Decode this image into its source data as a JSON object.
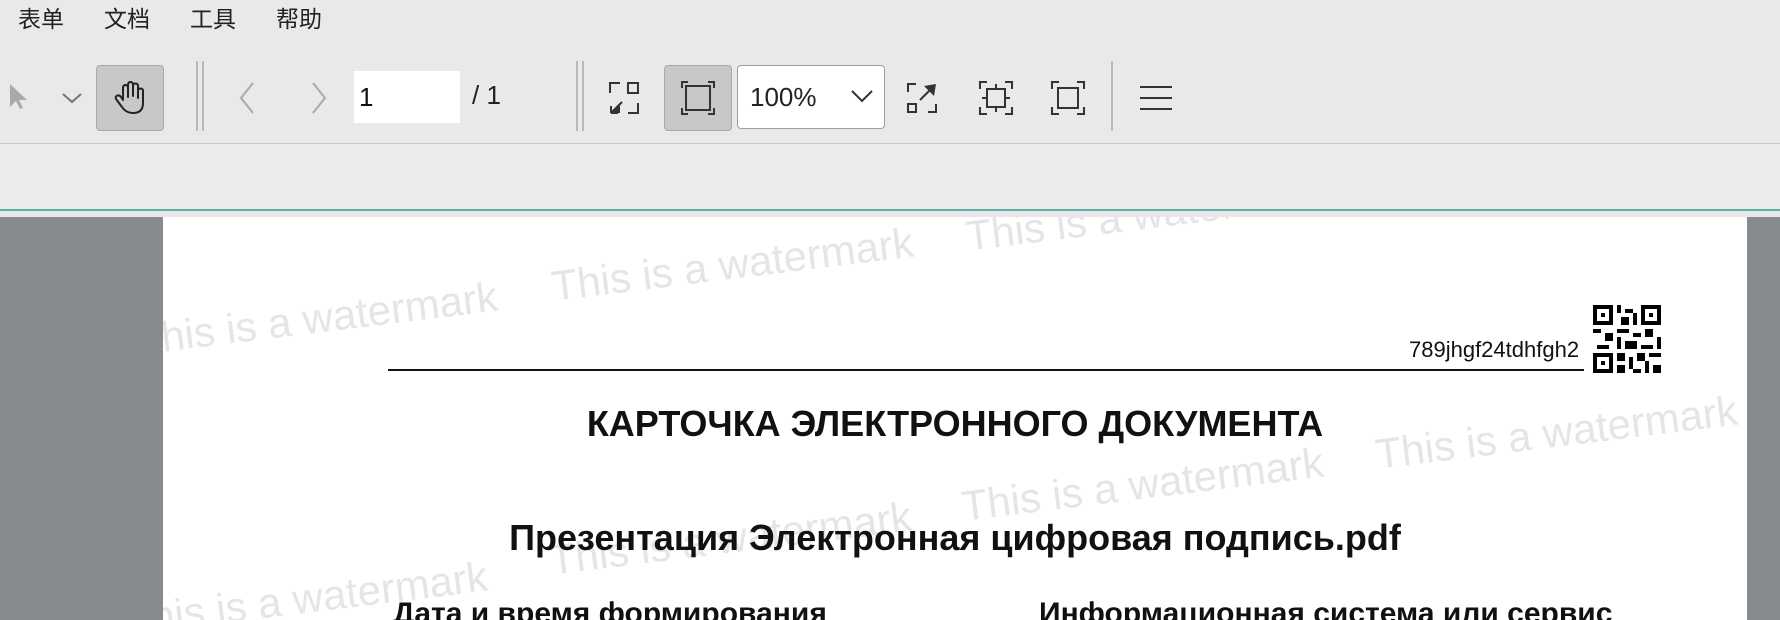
{
  "menu": {
    "items": [
      "表单",
      "文档",
      "工具",
      "帮助"
    ]
  },
  "toolbar": {
    "page_current": "1",
    "page_total": "/ 1",
    "zoom": "100%"
  },
  "document": {
    "code": "789jhgf24tdhfgh2",
    "title": "КАРТОЧКА ЭЛЕКТРОННОГО ДОКУМЕНТА",
    "filename": "Презентация Электронная цифровая подпись.pdf",
    "field_left_label": "Дата и время формирования",
    "field_right_label": "Информационная система или сервис",
    "watermark": "This is a watermark"
  },
  "colors": {
    "accent": "#5fb3a6",
    "viewer_bg": "#878a8f"
  }
}
